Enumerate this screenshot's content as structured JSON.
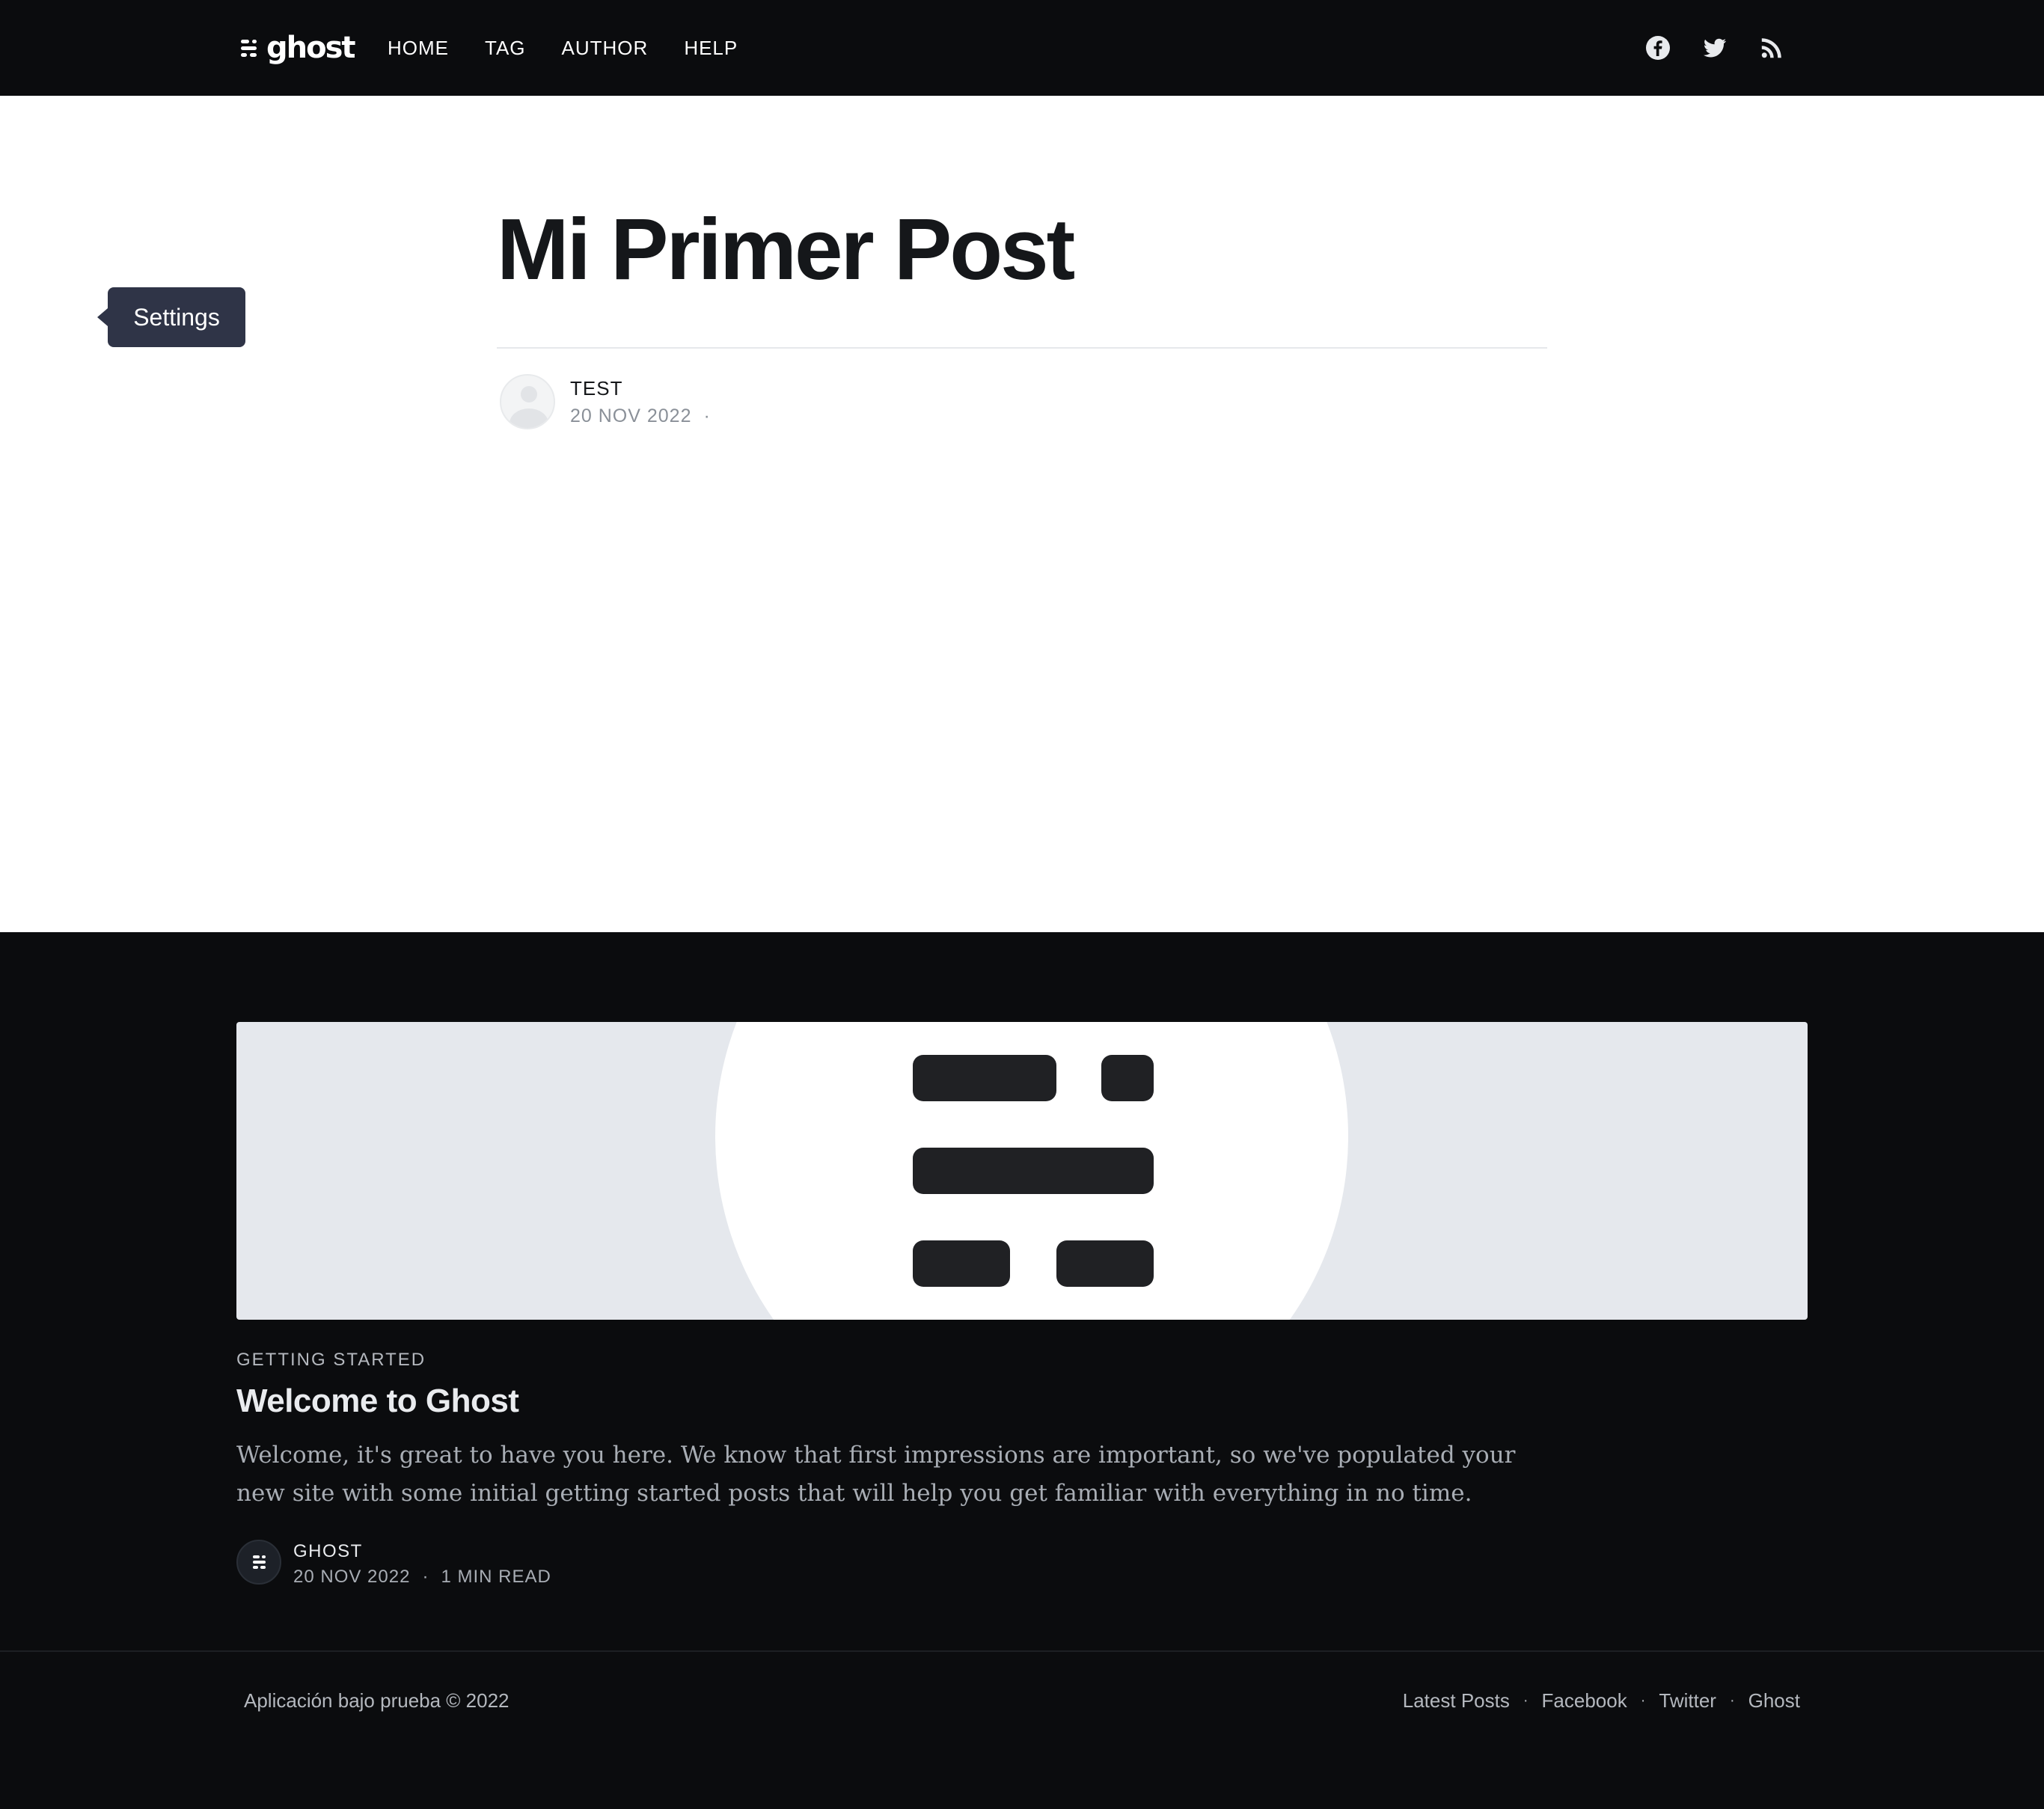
{
  "header": {
    "brand": "ghost",
    "nav": [
      "HOME",
      "TAG",
      "AUTHOR",
      "HELP"
    ],
    "social_icons": [
      "facebook-icon",
      "twitter-icon",
      "rss-icon"
    ]
  },
  "tooltip": {
    "label": "Settings"
  },
  "post": {
    "title": "Mi Primer Post",
    "author": "TEST",
    "date": "20 NOV 2022",
    "separator": "·"
  },
  "card": {
    "tag": "GETTING STARTED",
    "title": "Welcome to Ghost",
    "excerpt": "Welcome, it's great to have you here. We know that first impressions are important, so we've populated your new site with some initial getting started posts that will help you get familiar with everything in no time.",
    "author": "GHOST",
    "date": "20 NOV 2022",
    "separator": "·",
    "read_time": "1 MIN READ"
  },
  "footer": {
    "copyright": "Aplicación bajo prueba © 2022",
    "links": [
      "Latest Posts",
      "Facebook",
      "Twitter",
      "Ghost"
    ],
    "separator": "·"
  },
  "colors": {
    "header_bg": "#0b0c0e",
    "tooltip_bg": "#2f3447",
    "title_text": "#15171a"
  }
}
